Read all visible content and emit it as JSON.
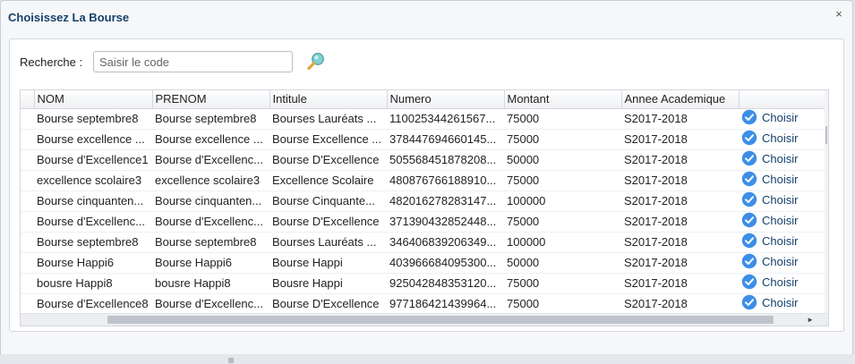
{
  "dialog": {
    "title": "Choisissez La Bourse",
    "close_icon": "close-icon",
    "close_symbol": "×"
  },
  "search": {
    "label": "Recherche :",
    "placeholder": "Saisir le code",
    "value": "",
    "icon": "magnifier-icon"
  },
  "table": {
    "columns": [
      "NOM",
      "PRENOM",
      "Intitule",
      "Numero",
      "Montant",
      "Annee Academique",
      ""
    ],
    "action_label": "Choisir",
    "action_icon": "check-circle-icon",
    "rows": [
      {
        "nom": "Bourse septembre8",
        "prenom": "Bourse septembre8",
        "intitule": "Bourses Lauréats ...",
        "numero": "110025344261567...",
        "montant": "75000",
        "annee": "S2017-2018"
      },
      {
        "nom": "Bourse excellence ...",
        "prenom": "Bourse excellence ...",
        "intitule": "Bourse Excellence ...",
        "numero": "378447694660145...",
        "montant": "75000",
        "annee": "S2017-2018"
      },
      {
        "nom": "Bourse d'Excellence1",
        "prenom": "Bourse d'Excellenc...",
        "intitule": "Bourse D'Excellence",
        "numero": "505568451878208...",
        "montant": "50000",
        "annee": "S2017-2018"
      },
      {
        "nom": "excellence scolaire3",
        "prenom": "excellence scolaire3",
        "intitule": "Excellence Scolaire",
        "numero": "480876766188910...",
        "montant": "75000",
        "annee": "S2017-2018"
      },
      {
        "nom": "Bourse cinquanten...",
        "prenom": "Bourse cinquanten...",
        "intitule": "Bourse Cinquante...",
        "numero": "482016278283147...",
        "montant": "100000",
        "annee": "S2017-2018"
      },
      {
        "nom": "Bourse d'Excellenc...",
        "prenom": "Bourse d'Excellenc...",
        "intitule": "Bourse D'Excellence",
        "numero": "371390432852448...",
        "montant": "75000",
        "annee": "S2017-2018"
      },
      {
        "nom": "Bourse septembre8",
        "prenom": "Bourse septembre8",
        "intitule": "Bourses Lauréats ...",
        "numero": "346406839206349...",
        "montant": "100000",
        "annee": "S2017-2018"
      },
      {
        "nom": "Bourse Happi6",
        "prenom": "Bourse Happi6",
        "intitule": "Bourse Happi",
        "numero": "403966684095300...",
        "montant": "50000",
        "annee": "S2017-2018"
      },
      {
        "nom": "bousre Happi8",
        "prenom": "bousre Happi8",
        "intitule": "Bousre Happi",
        "numero": "925042848353120...",
        "montant": "75000",
        "annee": "S2017-2018"
      },
      {
        "nom": "Bourse d'Excellence8",
        "prenom": "Bourse d'Excellenc...",
        "intitule": "Bourse D'Excellence",
        "numero": "977186421439964...",
        "montant": "75000",
        "annee": "S2017-2018"
      }
    ]
  },
  "colors": {
    "title": "#15416b",
    "check_icon": "#3d8ee8",
    "magnifier_lens": "#7fd2d6",
    "magnifier_handle": "#e0a63a"
  }
}
